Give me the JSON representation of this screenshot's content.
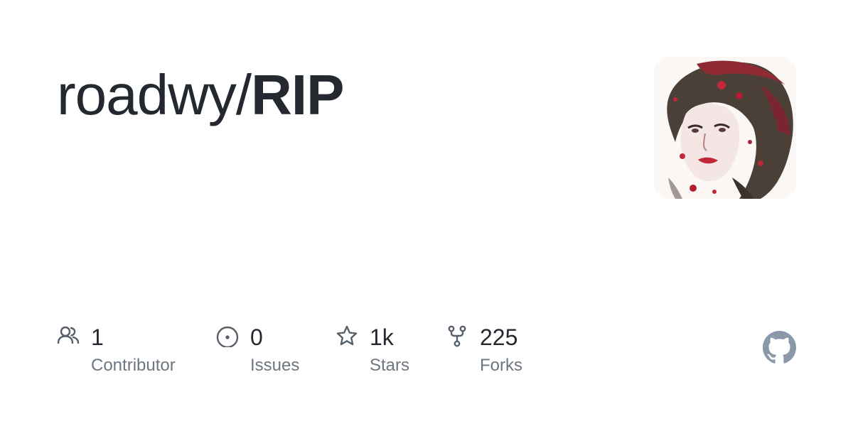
{
  "repo": {
    "owner": "roadwy/",
    "name": "RIP"
  },
  "stats": [
    {
      "value": "1",
      "label": "Contributor",
      "icon": "people-icon"
    },
    {
      "value": "0",
      "label": "Issues",
      "icon": "issue-opened-icon"
    },
    {
      "value": "1k",
      "label": "Stars",
      "icon": "star-icon"
    },
    {
      "value": "225",
      "label": "Forks",
      "icon": "repo-forked-icon"
    }
  ],
  "colors": {
    "title": "#24292f",
    "label": "#6e7781",
    "icon": "#57606a",
    "github_mark": "#8b98a8"
  }
}
